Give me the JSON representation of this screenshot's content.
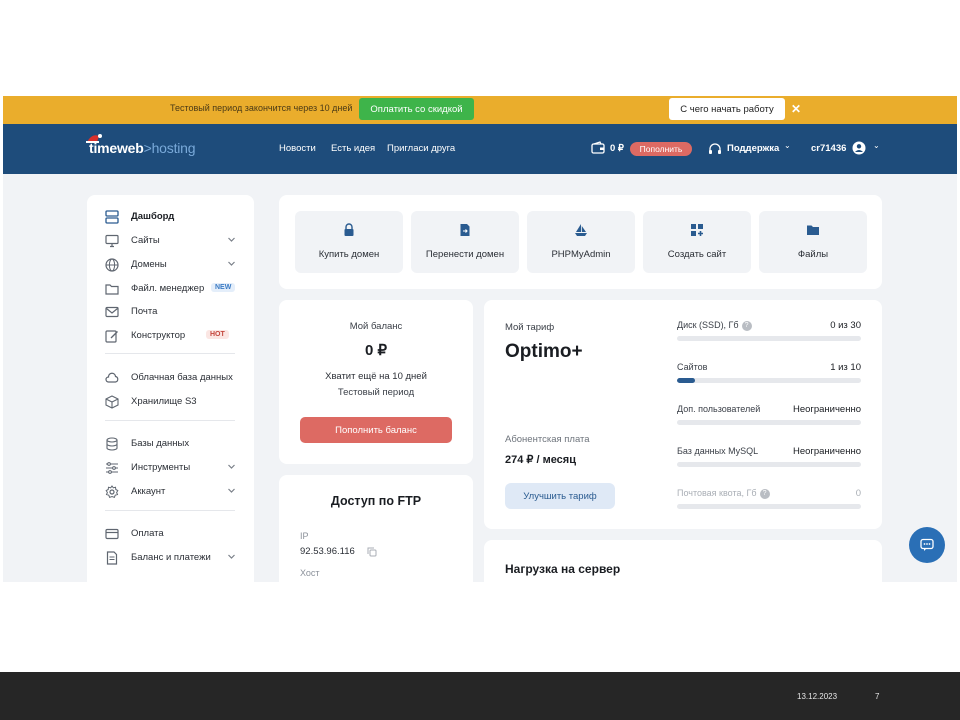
{
  "banner": {
    "trial_text": "Тестовый период закончится через 10 дней",
    "pay_button": "Оплатить со скидкой",
    "start_button": "С чего начать работу",
    "close_glyph": "✕"
  },
  "header": {
    "logo_main": "timeweb",
    "logo_accent": ">hosting",
    "nav": [
      "Новости",
      "Есть идея",
      "Пригласи друга"
    ],
    "balance": "0 ₽",
    "topup_label": "Пополнить",
    "support_label": "Поддержка",
    "username": "cr71436",
    "chevron": "⌄"
  },
  "sidebar": {
    "items": [
      {
        "label": "Дашборд",
        "icon": "server-icon",
        "active": true
      },
      {
        "label": "Сайты",
        "icon": "monitor-icon",
        "expandable": true
      },
      {
        "label": "Домены",
        "icon": "globe-icon",
        "expandable": true
      },
      {
        "label": "Файл. менеджер",
        "icon": "folder-icon",
        "badge": "NEW"
      },
      {
        "label": "Почта",
        "icon": "mail-icon"
      },
      {
        "label": "Конструктор",
        "icon": "edit-icon",
        "badge": "HOT"
      },
      {
        "label": "Облачная база данных",
        "icon": "cloud-icon"
      },
      {
        "label": "Хранилище S3",
        "icon": "box-icon"
      },
      {
        "label": "Базы данных",
        "icon": "database-icon"
      },
      {
        "label": "Инструменты",
        "icon": "sliders-icon",
        "expandable": true
      },
      {
        "label": "Аккаунт",
        "icon": "gear-icon",
        "expandable": true
      },
      {
        "label": "Оплата",
        "icon": "card-icon"
      },
      {
        "label": "Баланс и платежи",
        "icon": "document-icon",
        "expandable": true
      }
    ]
  },
  "quick_actions": [
    {
      "label": "Купить домен",
      "icon": "lock-icon"
    },
    {
      "label": "Перенести домен",
      "icon": "file-transfer-icon"
    },
    {
      "label": "PHPMyAdmin",
      "icon": "ship-icon"
    },
    {
      "label": "Создать сайт",
      "icon": "grid-plus-icon"
    },
    {
      "label": "Файлы",
      "icon": "folder-icon"
    }
  ],
  "balance_card": {
    "title": "Мой баланс",
    "amount": "0 ₽",
    "line1": "Хватит ещё на 10 дней",
    "line2": "Тестовый период",
    "button": "Пополнить баланс"
  },
  "ftp_card": {
    "title": "Доступ по FTP",
    "ip_label": "IP",
    "ip_value": "92.53.96.116",
    "host_label": "Хост"
  },
  "tariff_card": {
    "label": "Мой тариф",
    "name": "Optimo+",
    "fee_label": "Абонентская плата",
    "fee_value": "274 ₽ / месяц",
    "upgrade_button": "Улучшить тариф",
    "resources": [
      {
        "label": "Диск (SSD), Гб",
        "value": "0 из 30",
        "fill": 0.0,
        "info": true
      },
      {
        "label": "Сайтов",
        "value": "1 из 10",
        "fill": 0.1
      },
      {
        "label": "Доп. пользователей",
        "value": "Неограниченно",
        "fill": 0.0
      },
      {
        "label": "Баз данных MySQL",
        "value": "Неограниченно",
        "fill": 0.0
      },
      {
        "label": "Почтовая квота, Гб",
        "value": "0",
        "fill": 0.0,
        "info": true,
        "muted": true
      }
    ]
  },
  "load_card": {
    "title": "Нагрузка на сервер"
  },
  "slide_footer": {
    "date": "13.12.2023",
    "page": "7"
  },
  "colors": {
    "banner": "#eaad2c",
    "header": "#1e4c7b",
    "pay_green": "#3eb44a",
    "accent_red": "#dd6a63",
    "primary_blue": "#2a5b90"
  }
}
